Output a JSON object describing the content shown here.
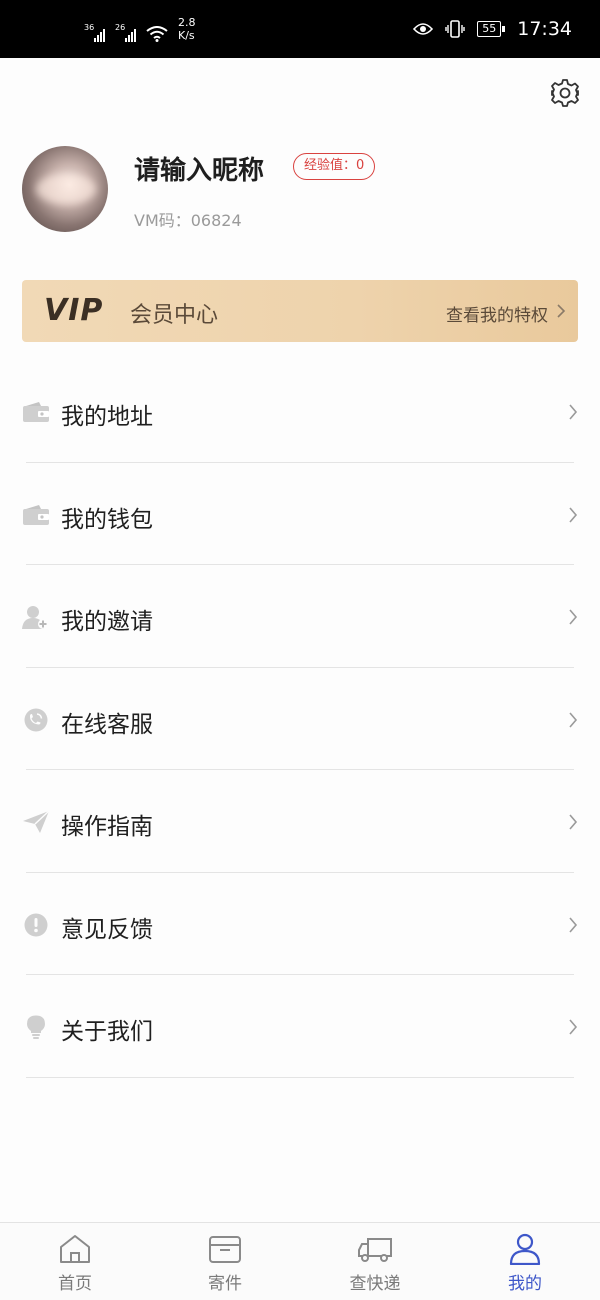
{
  "status_bar": {
    "signal1_tag": "36",
    "signal2_tag": "26",
    "speed_value": "2.8",
    "speed_unit": "K/s",
    "battery": "55",
    "time": "17:34"
  },
  "profile": {
    "nickname": "请输入昵称",
    "exp_badge": "经验值：0",
    "vm_code": "VM码：06824"
  },
  "vip": {
    "logo": "VIP",
    "title": "会员中心",
    "link": "查看我的特权"
  },
  "menu": [
    {
      "label": "我的地址",
      "icon": "wallet-icon"
    },
    {
      "label": "我的钱包",
      "icon": "wallet-icon"
    },
    {
      "label": "我的邀请",
      "icon": "user-add-icon"
    },
    {
      "label": "在线客服",
      "icon": "phone-icon"
    },
    {
      "label": "操作指南",
      "icon": "send-icon"
    },
    {
      "label": "意见反馈",
      "icon": "feedback-icon"
    },
    {
      "label": "关于我们",
      "icon": "bulb-icon"
    }
  ],
  "tabbar": [
    {
      "label": "首页",
      "icon": "home-icon",
      "active": false
    },
    {
      "label": "寄件",
      "icon": "box-icon",
      "active": false
    },
    {
      "label": "查快递",
      "icon": "truck-icon",
      "active": false
    },
    {
      "label": "我的",
      "icon": "user-icon",
      "active": true
    }
  ],
  "colors": {
    "active_tab": "#3e57c9",
    "exp_badge": "#d9423f",
    "vip_banner": "#efd6b1",
    "icon_gray": "#c4c4c4"
  }
}
